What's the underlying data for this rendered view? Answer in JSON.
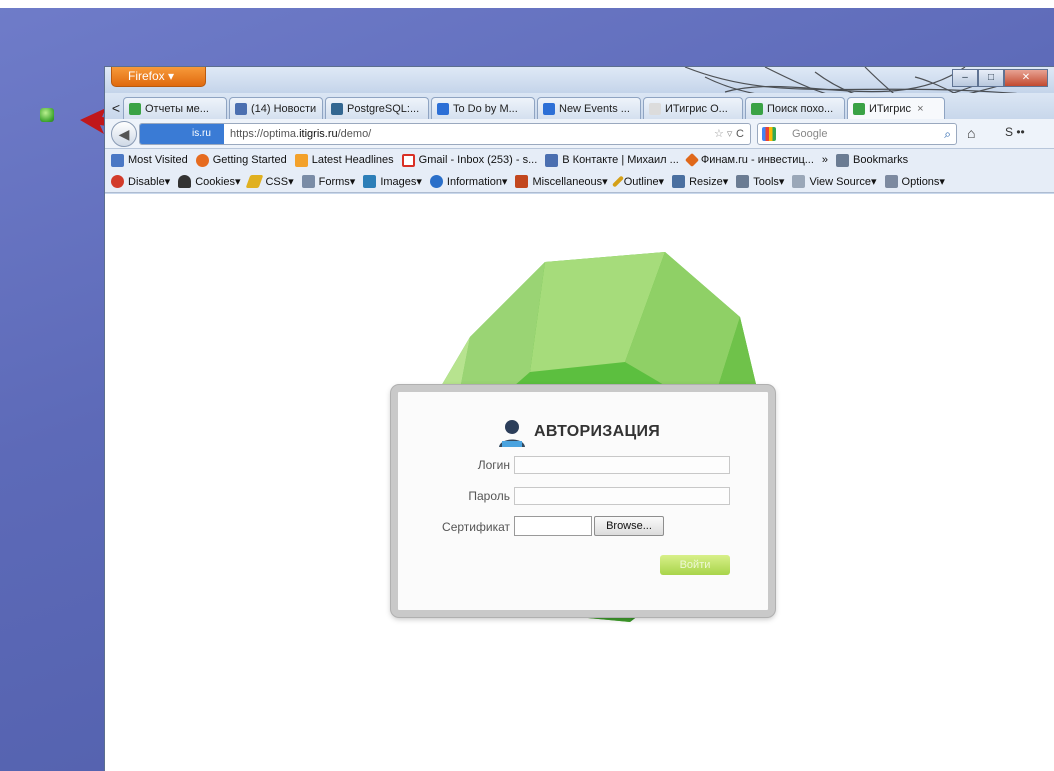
{
  "browser": {
    "menu_label": "Firefox ▾",
    "tabs": [
      {
        "label": "Отчеты ме...",
        "color": "#3aa245"
      },
      {
        "label": "(14) Новости",
        "color": "#4b6fb0"
      },
      {
        "label": "PostgreSQL:...",
        "color": "#336791"
      },
      {
        "label": "To Do by M...",
        "color": "#2c6fd6"
      },
      {
        "label": "New Events ...",
        "color": "#2c6fd6"
      },
      {
        "label": "ИТигрис О...",
        "color": "#dcdcdc"
      },
      {
        "label": "Поиск похо...",
        "color": "#3aa245"
      },
      {
        "label": "ИТигрис",
        "color": "#3aa245"
      }
    ],
    "tab_close": "×",
    "tab_scroll_left": "<",
    "site_identity": "is.ru",
    "url_prefix": "https://optima.",
    "url_domain": "itigris.ru",
    "url_path": "/demo/",
    "url_star": "☆ ▿",
    "url_reload": "C",
    "search_placeholder": "Google",
    "search_icon": "⌕",
    "home_icon": "⌂",
    "nav_overflow": "S ••",
    "win_minimize": "–",
    "win_maximize": "□",
    "win_close": "✕"
  },
  "bookmarks": {
    "items": [
      {
        "label": "Most Visited",
        "color": "#4a77c4"
      },
      {
        "label": "Getting Started",
        "color": "#e66b1f"
      },
      {
        "label": "Latest Headlines",
        "color": "#f3a12a"
      },
      {
        "label": "Gmail - Inbox (253) - s...",
        "color": "#d93025"
      },
      {
        "label": "В Контакте | Михаил ...",
        "color": "#4b6fb0"
      },
      {
        "label": "Финам.ru - инвестиц...",
        "color": "#e0681a"
      }
    ],
    "overflow": "»",
    "bookmarks_label": "Bookmarks"
  },
  "devtoolbar": {
    "items": [
      {
        "label": "Disable▾",
        "color": "#d23b2a"
      },
      {
        "label": "Cookies▾",
        "color": "#333333"
      },
      {
        "label": "CSS▾",
        "color": "#e0b020"
      },
      {
        "label": "Forms▾",
        "color": "#7a8ca6"
      },
      {
        "label": "Images▾",
        "color": "#2d7fb8"
      },
      {
        "label": "Information▾",
        "color": "#2a6fc9"
      },
      {
        "label": "Miscellaneous▾",
        "color": "#c2461d"
      },
      {
        "label": "Outline▾",
        "color": "#d4a017"
      },
      {
        "label": "Resize▾",
        "color": "#4a6fa0"
      },
      {
        "label": "Tools▾",
        "color": "#6b7c93"
      },
      {
        "label": "View Source▾",
        "color": "#9aa7b8"
      },
      {
        "label": "Options▾",
        "color": "#7d8aa0"
      }
    ]
  },
  "login": {
    "title": "АВТОРИЗАЦИЯ",
    "login_label": "Логин",
    "password_label": "Пароль",
    "certificate_label": "Сертификат",
    "browse_label": "Browse...",
    "submit_label": "Войти",
    "accent_color": "#a8d44a"
  }
}
